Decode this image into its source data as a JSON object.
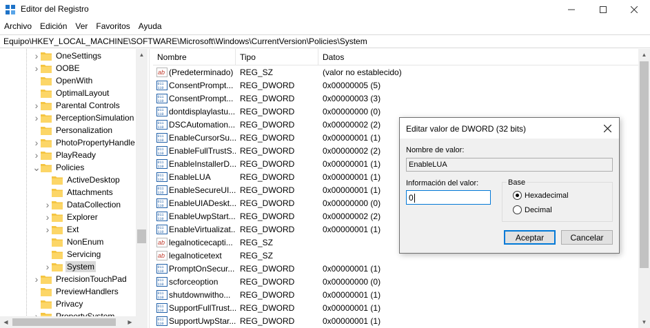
{
  "window": {
    "title": "Editor del Registro"
  },
  "menu": [
    "Archivo",
    "Edición",
    "Ver",
    "Favoritos",
    "Ayuda"
  ],
  "address": "Equipo\\HKEY_LOCAL_MACHINE\\SOFTWARE\\Microsoft\\Windows\\CurrentVersion\\Policies\\System",
  "tree": [
    {
      "label": "OneSettings",
      "level": 1,
      "expandable": true
    },
    {
      "label": "OOBE",
      "level": 1,
      "expandable": true
    },
    {
      "label": "OpenWith",
      "level": 1,
      "expandable": false
    },
    {
      "label": "OptimalLayout",
      "level": 1,
      "expandable": false
    },
    {
      "label": "Parental Controls",
      "level": 1,
      "expandable": true
    },
    {
      "label": "PerceptionSimulation",
      "level": 1,
      "expandable": true
    },
    {
      "label": "Personalization",
      "level": 1,
      "expandable": false
    },
    {
      "label": "PhotoPropertyHandle",
      "level": 1,
      "expandable": true
    },
    {
      "label": "PlayReady",
      "level": 1,
      "expandable": true
    },
    {
      "label": "Policies",
      "level": 1,
      "expandable": true,
      "expanded": true
    },
    {
      "label": "ActiveDesktop",
      "level": 2,
      "expandable": false
    },
    {
      "label": "Attachments",
      "level": 2,
      "expandable": false
    },
    {
      "label": "DataCollection",
      "level": 2,
      "expandable": true
    },
    {
      "label": "Explorer",
      "level": 2,
      "expandable": true
    },
    {
      "label": "Ext",
      "level": 2,
      "expandable": true
    },
    {
      "label": "NonEnum",
      "level": 2,
      "expandable": false
    },
    {
      "label": "Servicing",
      "level": 2,
      "expandable": false
    },
    {
      "label": "System",
      "level": 2,
      "expandable": true,
      "selected": true
    },
    {
      "label": "PrecisionTouchPad",
      "level": 1,
      "expandable": true
    },
    {
      "label": "PreviewHandlers",
      "level": 1,
      "expandable": false
    },
    {
      "label": "Privacy",
      "level": 1,
      "expandable": false
    },
    {
      "label": "PropertySystem",
      "level": 1,
      "expandable": true
    }
  ],
  "list": {
    "headers": [
      "Nombre",
      "Tipo",
      "Datos"
    ],
    "rows": [
      {
        "name": "(Predeterminado)",
        "type": "REG_SZ",
        "data": "(valor no establecido)",
        "icon": "string-value-icon"
      },
      {
        "name": "ConsentPrompt...",
        "type": "REG_DWORD",
        "data": "0x00000005 (5)",
        "icon": "dword-value-icon"
      },
      {
        "name": "ConsentPrompt...",
        "type": "REG_DWORD",
        "data": "0x00000003 (3)",
        "icon": "dword-value-icon"
      },
      {
        "name": "dontdisplaylastu...",
        "type": "REG_DWORD",
        "data": "0x00000000 (0)",
        "icon": "dword-value-icon"
      },
      {
        "name": "DSCAutomation...",
        "type": "REG_DWORD",
        "data": "0x00000002 (2)",
        "icon": "dword-value-icon"
      },
      {
        "name": "EnableCursorSu...",
        "type": "REG_DWORD",
        "data": "0x00000001 (1)",
        "icon": "dword-value-icon"
      },
      {
        "name": "EnableFullTrustS...",
        "type": "REG_DWORD",
        "data": "0x00000002 (2)",
        "icon": "dword-value-icon"
      },
      {
        "name": "EnableInstallerD...",
        "type": "REG_DWORD",
        "data": "0x00000001 (1)",
        "icon": "dword-value-icon"
      },
      {
        "name": "EnableLUA",
        "type": "REG_DWORD",
        "data": "0x00000001 (1)",
        "icon": "dword-value-icon"
      },
      {
        "name": "EnableSecureUI...",
        "type": "REG_DWORD",
        "data": "0x00000001 (1)",
        "icon": "dword-value-icon"
      },
      {
        "name": "EnableUIADeskt...",
        "type": "REG_DWORD",
        "data": "0x00000000 (0)",
        "icon": "dword-value-icon"
      },
      {
        "name": "EnableUwpStart...",
        "type": "REG_DWORD",
        "data": "0x00000002 (2)",
        "icon": "dword-value-icon"
      },
      {
        "name": "EnableVirtualizat...",
        "type": "REG_DWORD",
        "data": "0x00000001 (1)",
        "icon": "dword-value-icon"
      },
      {
        "name": "legalnoticecapti...",
        "type": "REG_SZ",
        "data": "",
        "icon": "string-value-icon"
      },
      {
        "name": "legalnoticetext",
        "type": "REG_SZ",
        "data": "",
        "icon": "string-value-icon"
      },
      {
        "name": "PromptOnSecur...",
        "type": "REG_DWORD",
        "data": "0x00000001 (1)",
        "icon": "dword-value-icon"
      },
      {
        "name": "scforceoption",
        "type": "REG_DWORD",
        "data": "0x00000000 (0)",
        "icon": "dword-value-icon"
      },
      {
        "name": "shutdownwitho...",
        "type": "REG_DWORD",
        "data": "0x00000001 (1)",
        "icon": "dword-value-icon"
      },
      {
        "name": "SupportFullTrust...",
        "type": "REG_DWORD",
        "data": "0x00000001 (1)",
        "icon": "dword-value-icon"
      },
      {
        "name": "SupportUwpStar...",
        "type": "REG_DWORD",
        "data": "0x00000001 (1)",
        "icon": "dword-value-icon"
      }
    ]
  },
  "dialog": {
    "title": "Editar valor de DWORD (32 bits)",
    "value_name_label": "Nombre de valor:",
    "value_name": "EnableLUA",
    "value_data_label": "Información del valor:",
    "value_data": "0",
    "base_label": "Base",
    "hex_label": "Hexadecimal",
    "dec_label": "Decimal",
    "selected_base": "Hexadecimal",
    "ok_label": "Aceptar",
    "cancel_label": "Cancelar"
  },
  "colors": {
    "folder": "#f5c542",
    "accent": "#0078d7",
    "selection": "#d9d9d9"
  }
}
